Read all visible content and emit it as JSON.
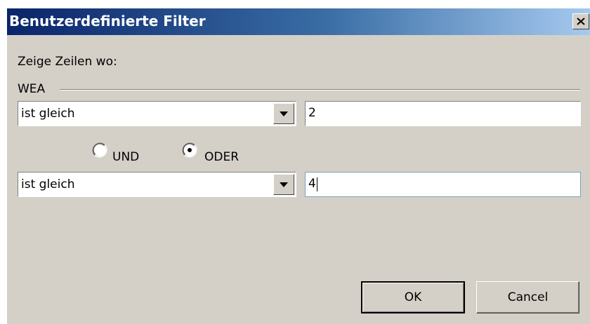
{
  "dialog": {
    "title": "Benutzerdefinierte Filter",
    "close_label": "X"
  },
  "filter": {
    "prompt": "Zeige Zeilen wo:",
    "column_name": "WEA",
    "condition1": {
      "operator": "ist gleich",
      "value": "2"
    },
    "logic": {
      "and_label": "UND",
      "or_label": "ODER",
      "selected": "ODER"
    },
    "condition2": {
      "operator": "ist gleich",
      "value": "4"
    }
  },
  "buttons": {
    "ok_label": "OK",
    "cancel_label": "Cancel"
  },
  "colors": {
    "titlebar_start": "#0a246a",
    "titlebar_end": "#a6caf0",
    "dialog_face": "#d4d0c8"
  }
}
